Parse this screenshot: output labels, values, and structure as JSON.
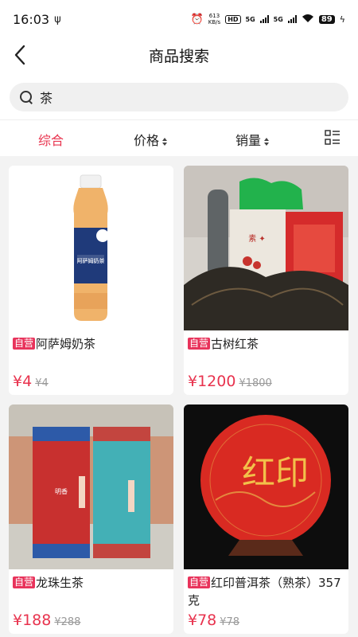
{
  "status": {
    "time": "16:03",
    "speed_value": "613",
    "speed_unit": "KB/s",
    "hd": "HD",
    "sim1": "5G",
    "sim2": "5G",
    "battery": "89"
  },
  "header": {
    "back_icon": "chevron-left-icon",
    "title": "商品搜索"
  },
  "search": {
    "value": "茶",
    "icon": "search-icon"
  },
  "sort": {
    "default_label": "综合",
    "price_label": "价格",
    "sales_label": "销量",
    "active_color": "#e8334e",
    "layout_icon": "grid-list-toggle-icon"
  },
  "products": [
    {
      "badge": "自营",
      "name": "阿萨姆奶茶",
      "price": "¥4",
      "old_price": "¥4"
    },
    {
      "badge": "自营",
      "name": "古树红茶",
      "price": "¥1200",
      "old_price": "¥1800"
    },
    {
      "badge": "自营",
      "name": "龙珠生茶",
      "price": "¥188",
      "old_price": "¥288"
    },
    {
      "badge": "自营",
      "name": "红印普洱茶（熟茶）357克",
      "price": "¥78",
      "old_price": "¥78"
    }
  ],
  "bottle_label": "阿萨姆奶茶",
  "cake_label": "红印",
  "tin_label": "明香",
  "brand_color": "#e8335b"
}
